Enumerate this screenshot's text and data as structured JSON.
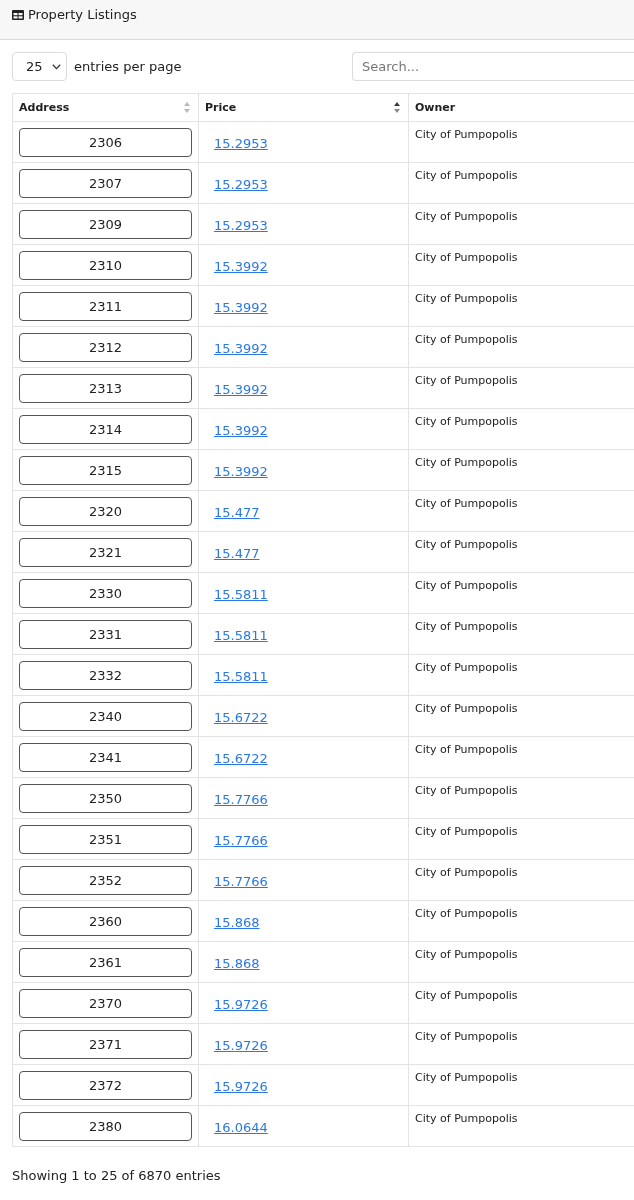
{
  "header": {
    "title": "Property Listings"
  },
  "controls": {
    "page_size": "25",
    "page_size_label": "entries per page",
    "search": {
      "placeholder": "Search..."
    }
  },
  "table": {
    "columns": [
      {
        "label": "Address",
        "sortable": true,
        "sorted": false
      },
      {
        "label": "Price",
        "sortable": true,
        "sorted": true
      },
      {
        "label": "Owner",
        "sortable": false
      }
    ],
    "rows": [
      {
        "address": "2306",
        "price": "15.2953",
        "owner": "City of Pumpopolis"
      },
      {
        "address": "2307",
        "price": "15.2953",
        "owner": "City of Pumpopolis"
      },
      {
        "address": "2309",
        "price": "15.2953",
        "owner": "City of Pumpopolis"
      },
      {
        "address": "2310",
        "price": "15.3992",
        "owner": "City of Pumpopolis"
      },
      {
        "address": "2311",
        "price": "15.3992",
        "owner": "City of Pumpopolis"
      },
      {
        "address": "2312",
        "price": "15.3992",
        "owner": "City of Pumpopolis"
      },
      {
        "address": "2313",
        "price": "15.3992",
        "owner": "City of Pumpopolis"
      },
      {
        "address": "2314",
        "price": "15.3992",
        "owner": "City of Pumpopolis"
      },
      {
        "address": "2315",
        "price": "15.3992",
        "owner": "City of Pumpopolis"
      },
      {
        "address": "2320",
        "price": "15.477",
        "owner": "City of Pumpopolis"
      },
      {
        "address": "2321",
        "price": "15.477",
        "owner": "City of Pumpopolis"
      },
      {
        "address": "2330",
        "price": "15.5811",
        "owner": "City of Pumpopolis"
      },
      {
        "address": "2331",
        "price": "15.5811",
        "owner": "City of Pumpopolis"
      },
      {
        "address": "2332",
        "price": "15.5811",
        "owner": "City of Pumpopolis"
      },
      {
        "address": "2340",
        "price": "15.6722",
        "owner": "City of Pumpopolis"
      },
      {
        "address": "2341",
        "price": "15.6722",
        "owner": "City of Pumpopolis"
      },
      {
        "address": "2350",
        "price": "15.7766",
        "owner": "City of Pumpopolis"
      },
      {
        "address": "2351",
        "price": "15.7766",
        "owner": "City of Pumpopolis"
      },
      {
        "address": "2352",
        "price": "15.7766",
        "owner": "City of Pumpopolis"
      },
      {
        "address": "2360",
        "price": "15.868",
        "owner": "City of Pumpopolis"
      },
      {
        "address": "2361",
        "price": "15.868",
        "owner": "City of Pumpopolis"
      },
      {
        "address": "2370",
        "price": "15.9726",
        "owner": "City of Pumpopolis"
      },
      {
        "address": "2371",
        "price": "15.9726",
        "owner": "City of Pumpopolis"
      },
      {
        "address": "2372",
        "price": "15.9726",
        "owner": "City of Pumpopolis"
      },
      {
        "address": "2380",
        "price": "16.0644",
        "owner": "City of Pumpopolis"
      }
    ]
  },
  "footer": {
    "summary": "Showing 1 to 25 of 6870 entries"
  }
}
